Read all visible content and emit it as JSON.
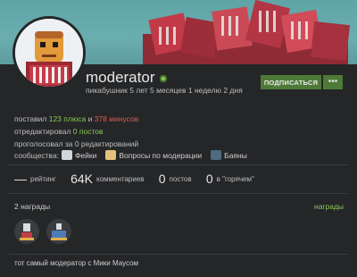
{
  "profile": {
    "username": "moderator",
    "since": "пикабушник 5 лет 5 месяцев 1 неделю 2 дня",
    "subscribe_label": "ПОДПИСАТЬСЯ",
    "more_label": "•••"
  },
  "info": {
    "line1_prefix": "поставил",
    "pluses": "123 плюса",
    "and": "и",
    "minuses": "378 минусов",
    "line2_prefix": "отредактировал",
    "edited": "0 постов",
    "line3_prefix": "проголосовал за",
    "voted": "0 редактирований",
    "communities_label": "сообщества:",
    "communities": [
      {
        "label": "Фейки",
        "icon": "fakes-community-icon"
      },
      {
        "label": "Вопросы по модерации",
        "icon": "moderation-questions-icon"
      },
      {
        "label": "Баяны",
        "icon": "bayans-community-icon"
      }
    ]
  },
  "stats": {
    "rating_value": "—",
    "rating_label": "рейтинг",
    "comments_value": "64K",
    "comments_label": "комментариев",
    "posts_value": "0",
    "posts_label": "постов",
    "hot_value": "0",
    "hot_label": "в \"горячем\""
  },
  "awards": {
    "title": "2 награды",
    "link": "награды",
    "items": [
      {
        "icon": "award-5-years-icon"
      },
      {
        "icon": "award-1000-icon"
      }
    ]
  },
  "about": "тот самый модератор с Мики Маусом",
  "colors": {
    "accent_green": "#8ac858",
    "minus_red": "#e05a4a",
    "button_green": "#4d7a38",
    "banner": "#6aaeb0"
  }
}
